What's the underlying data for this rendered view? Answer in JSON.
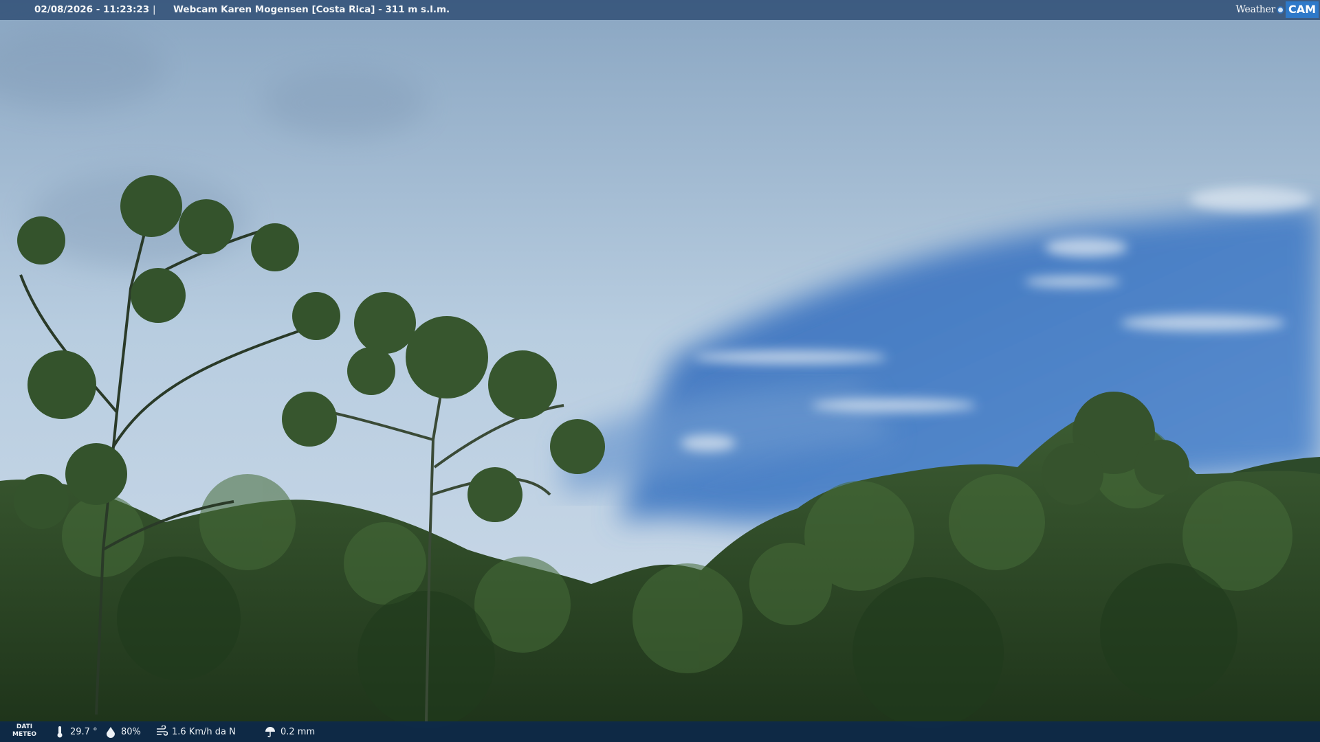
{
  "header": {
    "timestamp": "02/08/2026 - 11:23:23",
    "separator": "|",
    "camera_title": "Webcam Karen Mogensen [Costa Rica] - 311 m s.l.m."
  },
  "logo": {
    "weather": "Weather",
    "cam": "CAM"
  },
  "footer": {
    "dati_line1": "DATI",
    "dati_line2": "METEO",
    "temperature": "29.7 °",
    "humidity": "80%",
    "wind": "1.6 Km/h da N",
    "rain": "0.2 mm"
  },
  "icons": [
    "thermometer-icon",
    "humidity-drop-icon",
    "wind-icon",
    "rain-icon"
  ],
  "colors": {
    "sky": "#9fbcd8",
    "blue_sky": "#4a7fc4",
    "forest": "#2f4f27",
    "bar": "#0c284e"
  }
}
